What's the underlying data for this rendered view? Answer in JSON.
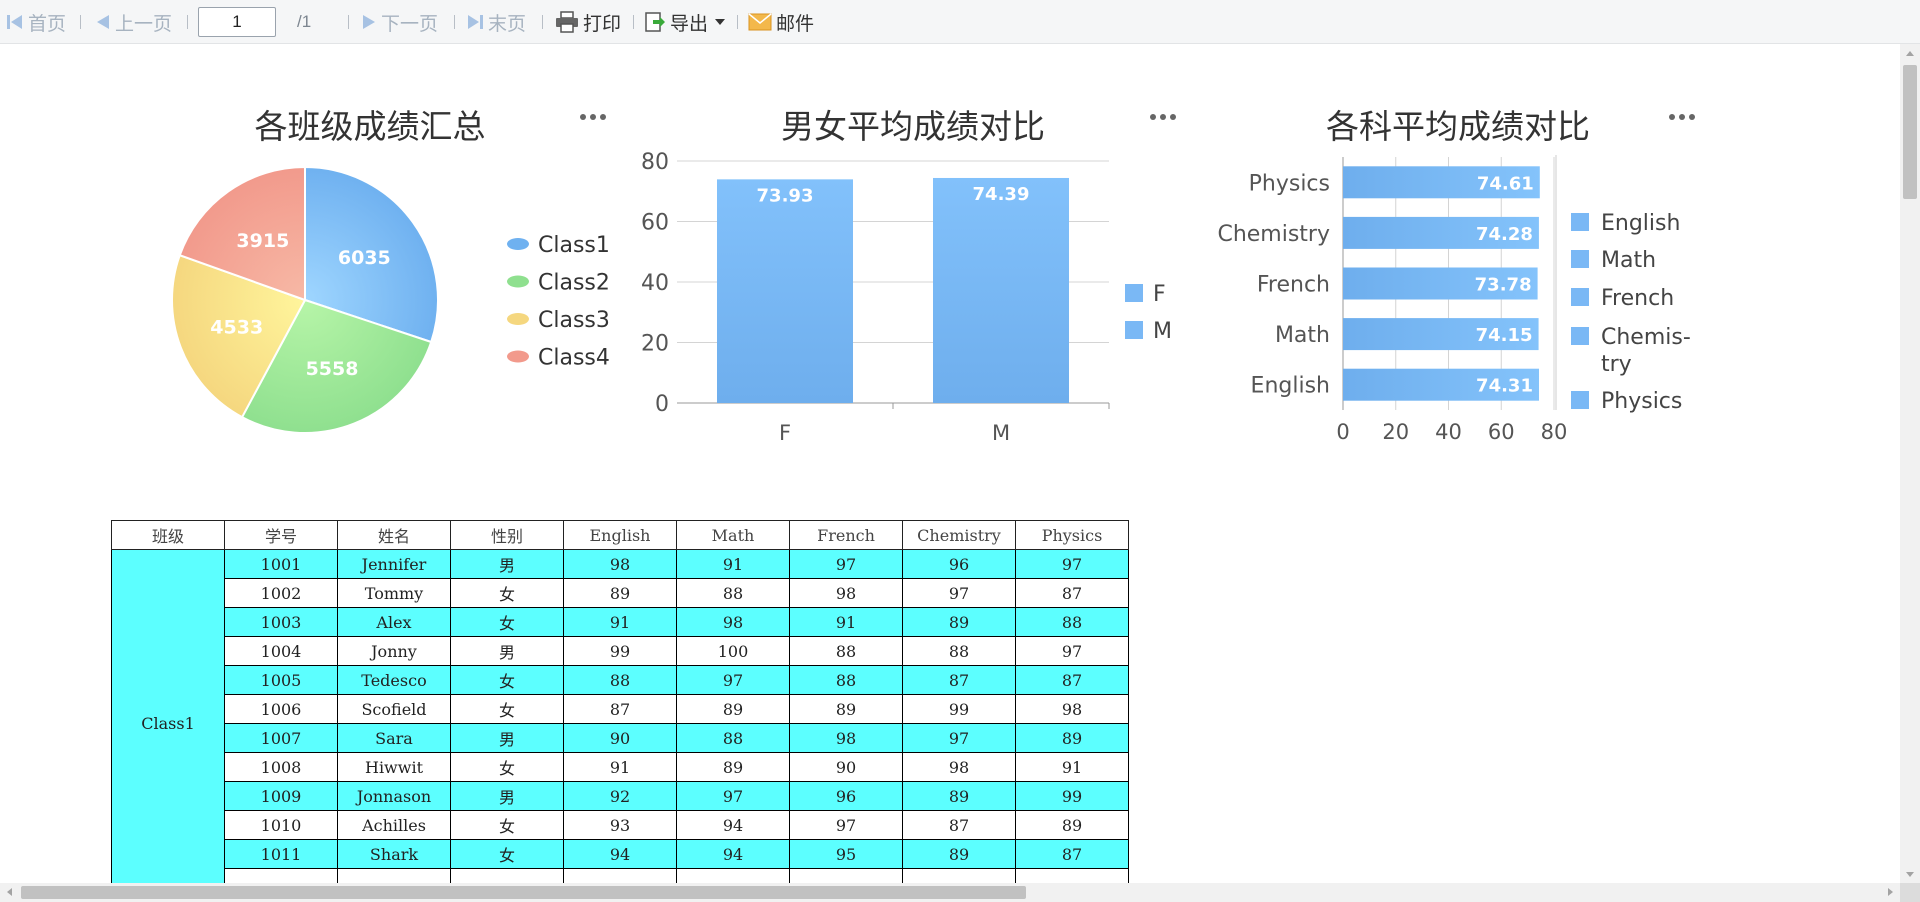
{
  "toolbar": {
    "first": "首页",
    "prev": "上一页",
    "page_value": "1",
    "page_total": "/1",
    "next": "下一页",
    "last": "末页",
    "print": "打印",
    "export": "导出",
    "mail": "邮件"
  },
  "colors": {
    "cyan_row": "#5cffff",
    "bar_blue": "#7ab8f5",
    "pie_class1": "#6fb1f0",
    "pie_class2": "#8fe08f",
    "pie_class3": "#f5d77f",
    "pie_class4": "#f29a8c"
  },
  "chart_data": [
    {
      "type": "pie",
      "title": "各班级成绩汇总",
      "categories": [
        "Class1",
        "Class2",
        "Class3",
        "Class4"
      ],
      "values": [
        6035,
        5558,
        4533,
        3915
      ],
      "legend": "right"
    },
    {
      "type": "bar",
      "title": "男女平均成绩对比",
      "categories": [
        "F",
        "M"
      ],
      "values": [
        73.93,
        74.39
      ],
      "value_labels": [
        "73.93",
        "74.39"
      ],
      "legend_items": [
        "F",
        "M"
      ],
      "ylim": [
        0,
        80
      ],
      "yticks": [
        "0",
        "20",
        "40",
        "60",
        "80"
      ],
      "grid": true,
      "legend": "right"
    },
    {
      "type": "bar",
      "orientation": "horizontal",
      "title": "各科平均成绩对比",
      "categories": [
        "Physics",
        "Chemistry",
        "French",
        "Math",
        "English"
      ],
      "values": [
        74.61,
        74.28,
        73.78,
        74.15,
        74.31
      ],
      "value_labels": [
        "74.61",
        "74.28",
        "73.78",
        "74.15",
        "74.31"
      ],
      "legend_items": [
        "English",
        "Math",
        "French",
        "Chemis-\ntry",
        "Physics"
      ],
      "xlim": [
        0,
        80
      ],
      "xticks": [
        "0",
        "20",
        "40",
        "60",
        "80"
      ],
      "grid": true,
      "legend": "right"
    }
  ],
  "table": {
    "headers": [
      "班级",
      "学号",
      "姓名",
      "性别",
      "English",
      "Math",
      "French",
      "Chemistry",
      "Physics"
    ],
    "class_label": "Class1",
    "rows": [
      [
        "1001",
        "Jennifer",
        "男",
        "98",
        "91",
        "97",
        "96",
        "97"
      ],
      [
        "1002",
        "Tommy",
        "女",
        "89",
        "88",
        "98",
        "97",
        "87"
      ],
      [
        "1003",
        "Alex",
        "女",
        "91",
        "98",
        "91",
        "89",
        "88"
      ],
      [
        "1004",
        "Jonny",
        "男",
        "99",
        "100",
        "88",
        "88",
        "97"
      ],
      [
        "1005",
        "Tedesco",
        "女",
        "88",
        "97",
        "88",
        "87",
        "87"
      ],
      [
        "1006",
        "Scofield",
        "女",
        "87",
        "89",
        "89",
        "99",
        "98"
      ],
      [
        "1007",
        "Sara",
        "男",
        "90",
        "88",
        "98",
        "97",
        "89"
      ],
      [
        "1008",
        "Hiwwit",
        "女",
        "91",
        "89",
        "90",
        "98",
        "91"
      ],
      [
        "1009",
        "Jonnason",
        "男",
        "92",
        "97",
        "96",
        "89",
        "99"
      ],
      [
        "1010",
        "Achilles",
        "女",
        "93",
        "94",
        "97",
        "87",
        "89"
      ],
      [
        "1011",
        "Shark",
        "女",
        "94",
        "94",
        "95",
        "89",
        "87"
      ]
    ]
  }
}
